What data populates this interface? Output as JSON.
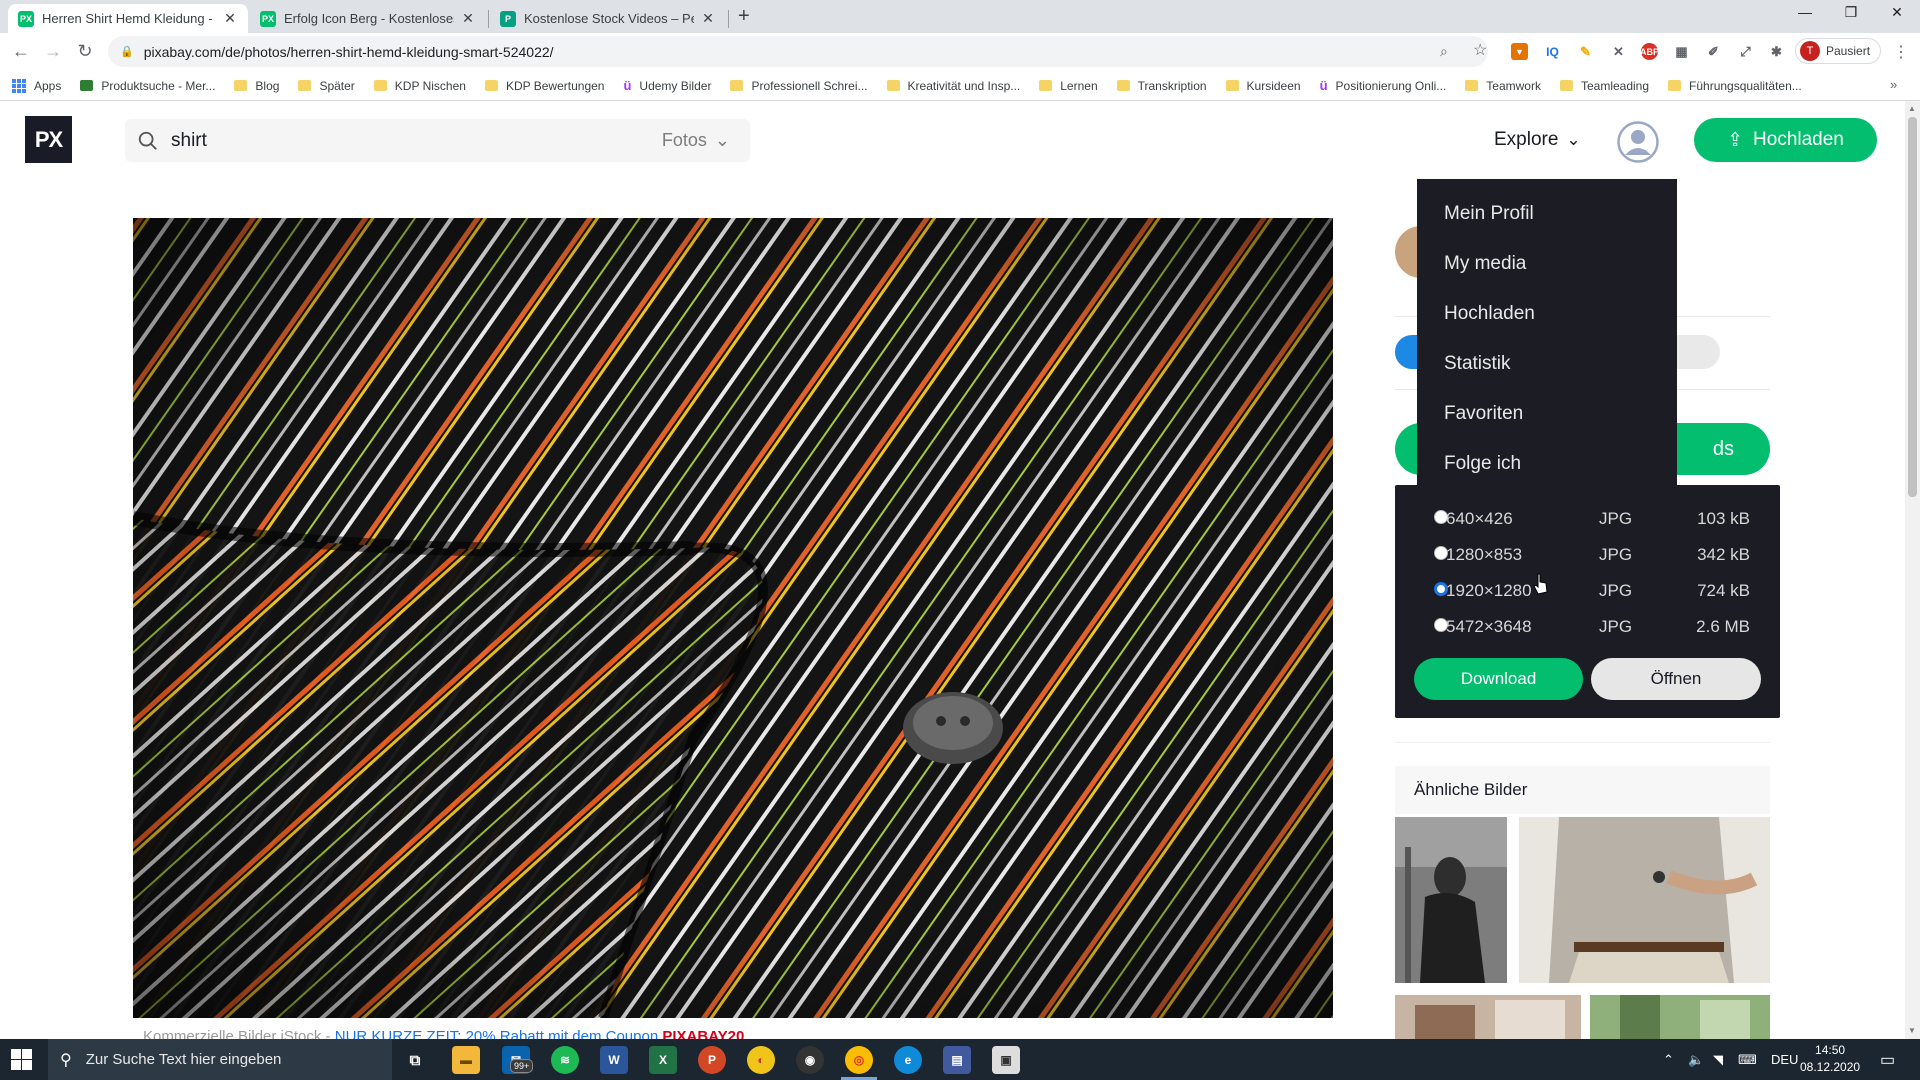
{
  "browser": {
    "tabs": [
      {
        "title": "Herren Shirt Hemd Kleidung - Ko",
        "favicon": "PX",
        "color": "#02be6e",
        "active": true
      },
      {
        "title": "Erfolg Icon Berg - Kostenloses Bi",
        "favicon": "PX",
        "color": "#02be6e",
        "active": false
      },
      {
        "title": "Kostenlose Stock Videos – Pexels",
        "favicon": "P",
        "color": "#05a081",
        "active": false
      }
    ],
    "url": "pixabay.com/de/photos/herren-shirt-hemd-kleidung-smart-524022/",
    "profile_initial": "T",
    "profile_status": "Pausiert",
    "bookmarks": [
      {
        "label": "Apps",
        "icon": "apps-grid-icon"
      },
      {
        "label": "Produktsuche - Mer...",
        "icon": "merch-icon"
      },
      {
        "label": "Blog",
        "icon": "folder-icon"
      },
      {
        "label": "Später",
        "icon": "folder-icon"
      },
      {
        "label": "KDP Nischen",
        "icon": "folder-icon"
      },
      {
        "label": "KDP Bewertungen",
        "icon": "folder-icon"
      },
      {
        "label": "Udemy Bilder",
        "icon": "udemy-icon"
      },
      {
        "label": "Professionell Schrei...",
        "icon": "folder-icon"
      },
      {
        "label": "Kreativität und Insp...",
        "icon": "folder-icon"
      },
      {
        "label": "Lernen",
        "icon": "folder-icon"
      },
      {
        "label": "Transkription",
        "icon": "folder-icon"
      },
      {
        "label": "Kursideen",
        "icon": "folder-icon"
      },
      {
        "label": "Positionierung Onli...",
        "icon": "udemy-icon"
      },
      {
        "label": "Teamwork",
        "icon": "folder-icon"
      },
      {
        "label": "Teamleading",
        "icon": "folder-icon"
      },
      {
        "label": "Führungsqualitäten...",
        "icon": "folder-icon"
      }
    ]
  },
  "site": {
    "logo": "PX",
    "search_value": "shirt",
    "search_type": "Fotos",
    "explore": "Explore",
    "upload": "Hochladen",
    "download_partial": "ds",
    "similar_title": "Ähnliche Bilder",
    "promo": {
      "prefix": "Kommerzielle Bilder iStock",
      "sep": " - ",
      "link": "NUR KURZE ZEIT: 20% Rabatt mit dem Coupon",
      "code": "PIXABAY20"
    },
    "accent": "#02be6e"
  },
  "user_menu": {
    "items": [
      "Mein Profil",
      "My media",
      "Hochladen",
      "Statistik",
      "Favoriten",
      "Folge ich"
    ]
  },
  "download_options": {
    "rows": [
      {
        "res": "640×426",
        "format": "JPG",
        "size": "103 kB",
        "selected": false
      },
      {
        "res": "1280×853",
        "format": "JPG",
        "size": "342 kB",
        "selected": false
      },
      {
        "res": "1920×1280",
        "format": "JPG",
        "size": "724 kB",
        "selected": true
      },
      {
        "res": "5472×3648",
        "format": "JPG",
        "size": "2.6 MB",
        "selected": false
      }
    ],
    "download_label": "Download",
    "open_label": "Öffnen"
  },
  "taskbar": {
    "search_placeholder": "Zur Suche Text hier eingeben",
    "mail_badge": "99+",
    "language": "DEU",
    "time": "14:50",
    "date": "08.12.2020"
  }
}
